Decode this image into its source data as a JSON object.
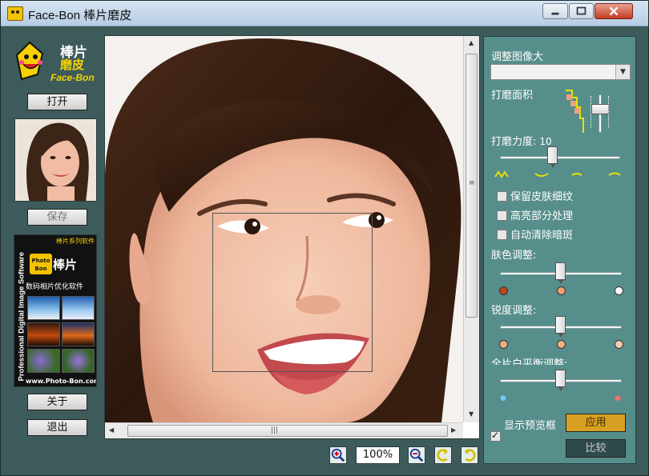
{
  "window": {
    "title": "Face-Bon 棒片磨皮"
  },
  "left": {
    "logo_brand": "棒片",
    "logo_brand2": "磨皮",
    "logo_name": "Face-Bon",
    "open_label": "打开",
    "save_label": "保存",
    "about_label": "关于",
    "exit_label": "退出"
  },
  "ad": {
    "series": "棒片系列软件",
    "vertical": "Professional Digital Image Software",
    "badge": "Photo Bon",
    "brand": "棒片",
    "subtitle": "数码相片优化软件",
    "url": "www.Photo-Bon.com"
  },
  "toolbar": {
    "zoom": "100%"
  },
  "right": {
    "resize_label": "调整图像大",
    "resize_value": "",
    "area_label": "打磨面积",
    "strength_label": "打磨力度:",
    "strength_value": "10",
    "strength_level": 0.43,
    "options": [
      {
        "label": "保留皮肤细纹",
        "checked": false
      },
      {
        "label": "高亮部分处理",
        "checked": false
      },
      {
        "label": "自动清除暗斑",
        "checked": false
      }
    ],
    "skin_label": "肤色调整:",
    "skin_level": 0.5,
    "sharp_label": "锐度调整:",
    "sharp_level": 0.5,
    "wb_label": "全片白平衡调整:",
    "wb_level": 0.5,
    "preview_label": "显示预览框",
    "preview_checked": true,
    "apply_label": "应用",
    "compare_label": "比较"
  },
  "colors": {
    "panel_bg": "#3d5b5b",
    "right_bg": "#568e8b",
    "apply_bg": "#d8a022",
    "compare_bg": "#2f4a4a"
  }
}
